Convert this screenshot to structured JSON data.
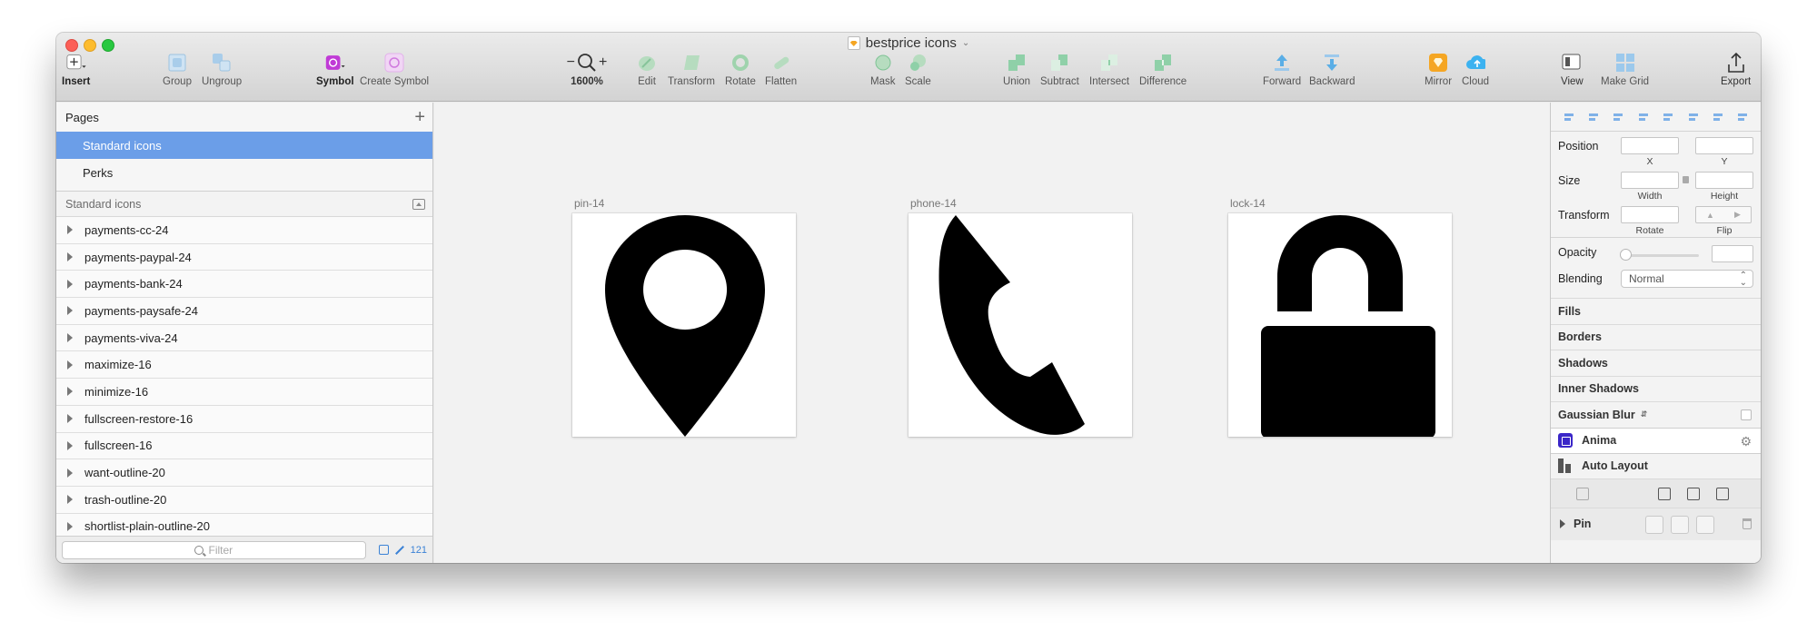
{
  "window": {
    "title": "bestprice icons"
  },
  "toolbar": {
    "insert": "Insert",
    "group": "Group",
    "ungroup": "Ungroup",
    "symbol": "Symbol",
    "create_symbol": "Create Symbol",
    "zoom": "1600%",
    "zoom_minus": "−",
    "zoom_plus": "+",
    "edit": "Edit",
    "transform": "Transform",
    "rotate": "Rotate",
    "flatten": "Flatten",
    "mask": "Mask",
    "scale": "Scale",
    "union": "Union",
    "subtract": "Subtract",
    "intersect": "Intersect",
    "difference": "Difference",
    "forward": "Forward",
    "backward": "Backward",
    "mirror": "Mirror",
    "cloud": "Cloud",
    "view": "View",
    "make_grid": "Make Grid",
    "export": "Export"
  },
  "pages": {
    "header": "Pages",
    "items": [
      {
        "label": "Standard icons",
        "selected": true
      },
      {
        "label": "Perks",
        "selected": false
      }
    ]
  },
  "layers": {
    "header": "Standard icons",
    "items": [
      "payments-cc-24",
      "payments-paypal-24",
      "payments-bank-24",
      "payments-paysafe-24",
      "payments-viva-24",
      "maximize-16",
      "minimize-16",
      "fullscreen-restore-16",
      "fullscreen-16",
      "want-outline-20",
      "trash-outline-20",
      "shortlist-plain-outline-20"
    ],
    "filter_placeholder": "Filter",
    "count": "121"
  },
  "artboards": [
    {
      "name": "pin-14",
      "icon": "map-pin-icon"
    },
    {
      "name": "phone-14",
      "icon": "phone-icon"
    },
    {
      "name": "lock-14",
      "icon": "lock-icon"
    }
  ],
  "inspector": {
    "position": "Position",
    "x": "X",
    "y": "Y",
    "size": "Size",
    "width": "Width",
    "height": "Height",
    "transform": "Transform",
    "rotate": "Rotate",
    "flip": "Flip",
    "opacity": "Opacity",
    "blending": "Blending",
    "blending_value": "Normal",
    "sections": [
      "Fills",
      "Borders",
      "Shadows",
      "Inner Shadows"
    ],
    "gaussian_blur": "Gaussian Blur",
    "anima": "Anima",
    "auto_layout": "Auto Layout",
    "pin": "Pin"
  },
  "colors": {
    "selection": "#6b9ee8",
    "symbol_purple": "#c03ad6",
    "shape_green": "#8fd0a8",
    "arrange_blue": "#5aaee6",
    "sketch_orange": "#f5a623",
    "cloud_blue": "#3cb2f0",
    "anima_purple": "#3a26c8"
  }
}
